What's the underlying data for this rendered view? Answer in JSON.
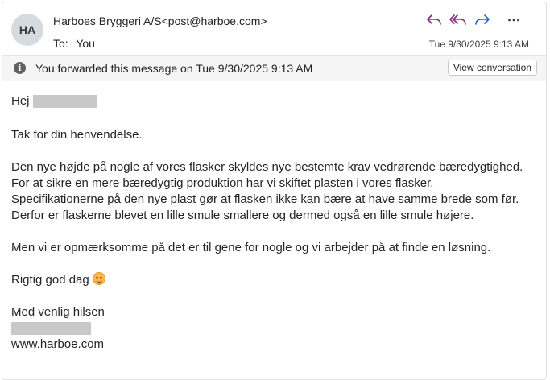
{
  "header": {
    "avatar_initials": "HA",
    "sender": "Harboes Bryggeri A/S<post@harboe.com>",
    "to_label": "To:",
    "to_value": "You",
    "timestamp": "Tue 9/30/2025 9:13 AM",
    "actions": [
      {
        "name": "reply-icon"
      },
      {
        "name": "reply-all-icon"
      },
      {
        "name": "forward-icon"
      },
      {
        "name": "more-icon"
      }
    ],
    "accent_color": "#8a2a8a"
  },
  "banner": {
    "icon": "info-icon",
    "text": "You forwarded this message on Tue 9/30/2025 9:13 AM",
    "button": "View conversation"
  },
  "body": {
    "greeting": "Hej",
    "p1": "Tak for din henvendelse.",
    "p2_lines": [
      "Den nye højde på nogle af vores flasker skyldes nye bestemte krav vedrørende bæredygtighed.",
      "For at sikre en mere bæredygtig produktion har vi skiftet plasten i vores flasker.",
      "Specifikationerne på den nye plast gør at flasken ikke kan bære at have samme brede som før.",
      "Derfor er flaskerne blevet en lille smule smallere og dermed også en lille smule højere."
    ],
    "p3": "Men vi er opmærksomme på det er til gene for nogle og vi arbejder på at finde en løsning.",
    "p4": "Rigtig god dag",
    "closing": "Med venlig hilsen",
    "website": "www.harboe.com"
  }
}
